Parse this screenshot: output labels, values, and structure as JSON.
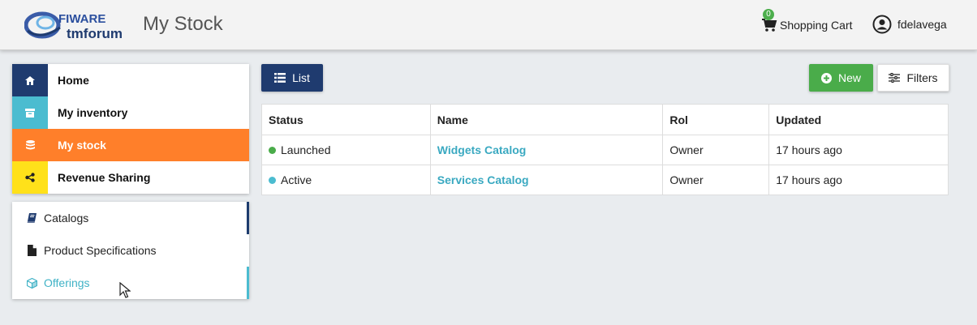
{
  "header": {
    "logo_top": "FIWARE",
    "logo_bottom": "tmforum",
    "title": "My Stock",
    "cart_label": "Shopping Cart",
    "cart_count": "0",
    "username": "fdelavega"
  },
  "nav": {
    "items": [
      {
        "label": "Home",
        "icon": "home-icon",
        "color": "#1f3b6f"
      },
      {
        "label": "My inventory",
        "icon": "archive-icon",
        "color": "#4bbcd0"
      },
      {
        "label": "My stock",
        "icon": "database-icon",
        "color": "#ff7f2a"
      },
      {
        "label": "Revenue Sharing",
        "icon": "share-icon",
        "color": "#ffe11a"
      }
    ]
  },
  "subnav": {
    "items": [
      {
        "label": "Catalogs",
        "icon": "book-icon"
      },
      {
        "label": "Product Specifications",
        "icon": "file-icon"
      },
      {
        "label": "Offerings",
        "icon": "cube-icon"
      }
    ]
  },
  "toolbar": {
    "list_label": "List",
    "new_label": "New",
    "filters_label": "Filters"
  },
  "table": {
    "headers": [
      "Status",
      "Name",
      "Rol",
      "Updated"
    ],
    "rows": [
      {
        "status": "Launched",
        "status_color": "#4aac4a",
        "name": "Widgets Catalog",
        "rol": "Owner",
        "updated": "17 hours ago"
      },
      {
        "status": "Active",
        "status_color": "#4bbcd0",
        "name": "Services Catalog",
        "rol": "Owner",
        "updated": "17 hours ago"
      }
    ]
  }
}
